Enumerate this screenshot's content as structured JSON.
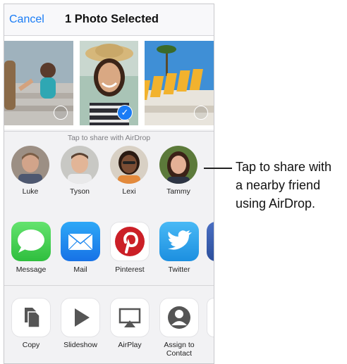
{
  "header": {
    "cancel_label": "Cancel",
    "title": "1 Photo Selected"
  },
  "photos": [
    {
      "name": "photo-friends",
      "selected": false
    },
    {
      "name": "photo-portrait",
      "selected": true
    },
    {
      "name": "photo-letters",
      "selected": false
    }
  ],
  "airdrop": {
    "hint": "Tap to share with AirDrop",
    "people": [
      {
        "name": "Luke"
      },
      {
        "name": "Tyson"
      },
      {
        "name": "Lexi"
      },
      {
        "name": "Tammy"
      }
    ]
  },
  "apps": [
    {
      "label": "Message",
      "icon": "message-icon",
      "color": "#3ccb4b"
    },
    {
      "label": "Mail",
      "icon": "mail-icon",
      "color": "#1e88f0"
    },
    {
      "label": "Pinterest",
      "icon": "pinterest-icon",
      "color": "#cb1f27"
    },
    {
      "label": "Twitter",
      "icon": "twitter-icon",
      "color": "#2aa3ef"
    }
  ],
  "actions": [
    {
      "label": "Copy",
      "icon": "copy-icon"
    },
    {
      "label": "Slideshow",
      "icon": "play-icon"
    },
    {
      "label": "AirPlay",
      "icon": "airplay-icon"
    },
    {
      "label": "Assign to Contact",
      "label_line1": "Assign to",
      "label_line2": "Contact",
      "icon": "contact-icon"
    }
  ],
  "callout": {
    "line1": "Tap to share with",
    "line2": "a nearby friend",
    "line3": "using AirDrop."
  },
  "colors": {
    "accent": "#1a7cf5"
  }
}
